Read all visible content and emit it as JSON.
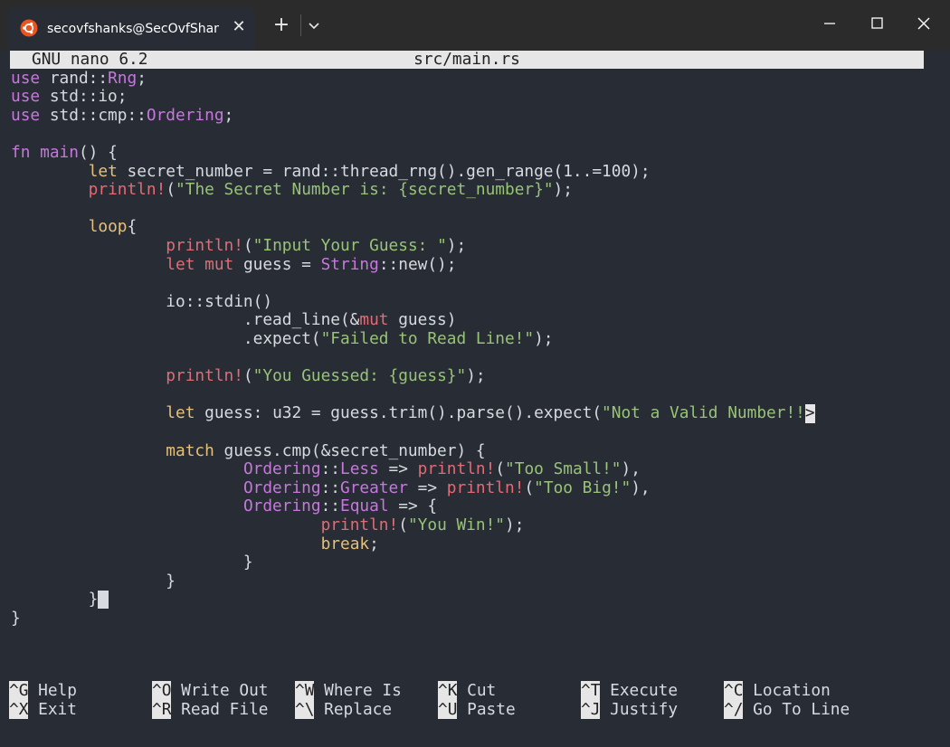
{
  "window": {
    "tab_title": "secovfshanks@SecOvfShanks:",
    "close_tab_glyph": "✕",
    "new_tab_glyph": "+"
  },
  "nano": {
    "version": "GNU nano 6.2",
    "filename": "src/main.rs"
  },
  "code": {
    "l1": [
      "use",
      " rand::",
      "Rng",
      ";"
    ],
    "l2": [
      "use",
      " std::io;"
    ],
    "l3": [
      "use",
      " std::cmp::",
      "Ordering",
      ";"
    ],
    "l5": [
      "fn",
      " ",
      "main",
      "() {"
    ],
    "l6": [
      "        ",
      "let",
      " secret_number = rand::thread_rng().gen_range(1..=100);"
    ],
    "l7": [
      "        ",
      "println!",
      "(",
      "\"The Secret Number is: {secret_number}\"",
      ");"
    ],
    "l9": [
      "        ",
      "loop",
      "{"
    ],
    "l10": [
      "                ",
      "println!",
      "(",
      "\"Input Your Guess: \"",
      ");"
    ],
    "l11": [
      "                ",
      "let mut",
      " guess = ",
      "String",
      "::new();"
    ],
    "l13": [
      "                io::stdin()"
    ],
    "l14": [
      "                        .read_line(&",
      "mut",
      " guess)"
    ],
    "l15": [
      "                        .expect(",
      "\"Failed to Read Line!\"",
      ");"
    ],
    "l17": [
      "                ",
      "println!",
      "(",
      "\"You Guessed: {guess}\"",
      ");"
    ],
    "l19": [
      "                ",
      "let",
      " guess: u32 = guess.trim().parse().expect(",
      "\"Not a Valid Number!!",
      ">"
    ],
    "l21": [
      "                ",
      "match",
      " guess.cmp(&secret_number) {"
    ],
    "l22": [
      "                        ",
      "Ordering",
      "::",
      "Less",
      " => ",
      "println!",
      "(",
      "\"Too Small!\"",
      "),"
    ],
    "l23": [
      "                        ",
      "Ordering",
      "::",
      "Greater",
      " => ",
      "println!",
      "(",
      "\"Too Big!\"",
      "),"
    ],
    "l24": [
      "                        ",
      "Ordering",
      "::",
      "Equal",
      " => {"
    ],
    "l25": [
      "                                ",
      "println!",
      "(",
      "\"You Win!\"",
      ");"
    ],
    "l26": [
      "                                ",
      "break",
      ";"
    ],
    "l27": [
      "                        }"
    ],
    "l28": [
      "                }"
    ],
    "l29": [
      "        }"
    ],
    "l30": [
      "}"
    ]
  },
  "shortcuts": [
    {
      "key1": "^G",
      "label1": "Help",
      "key2": "^X",
      "label2": "Exit"
    },
    {
      "key1": "^O",
      "label1": "Write Out",
      "key2": "^R",
      "label2": "Read File"
    },
    {
      "key1": "^W",
      "label1": "Where Is",
      "key2": "^\\",
      "label2": "Replace"
    },
    {
      "key1": "^K",
      "label1": "Cut",
      "key2": "^U",
      "label2": "Paste"
    },
    {
      "key1": "^T",
      "label1": "Execute",
      "key2": "^J",
      "label2": "Justify"
    },
    {
      "key1": "^C",
      "label1": "Location",
      "key2": "^/",
      "label2": "Go To Line"
    }
  ],
  "colors": {
    "background": "#282c34",
    "keyword": "#c678dd",
    "string": "#98c379",
    "macro": "#e06c75",
    "loop_keyword": "#e5c07b",
    "header_bg": "#e6e6e6"
  }
}
